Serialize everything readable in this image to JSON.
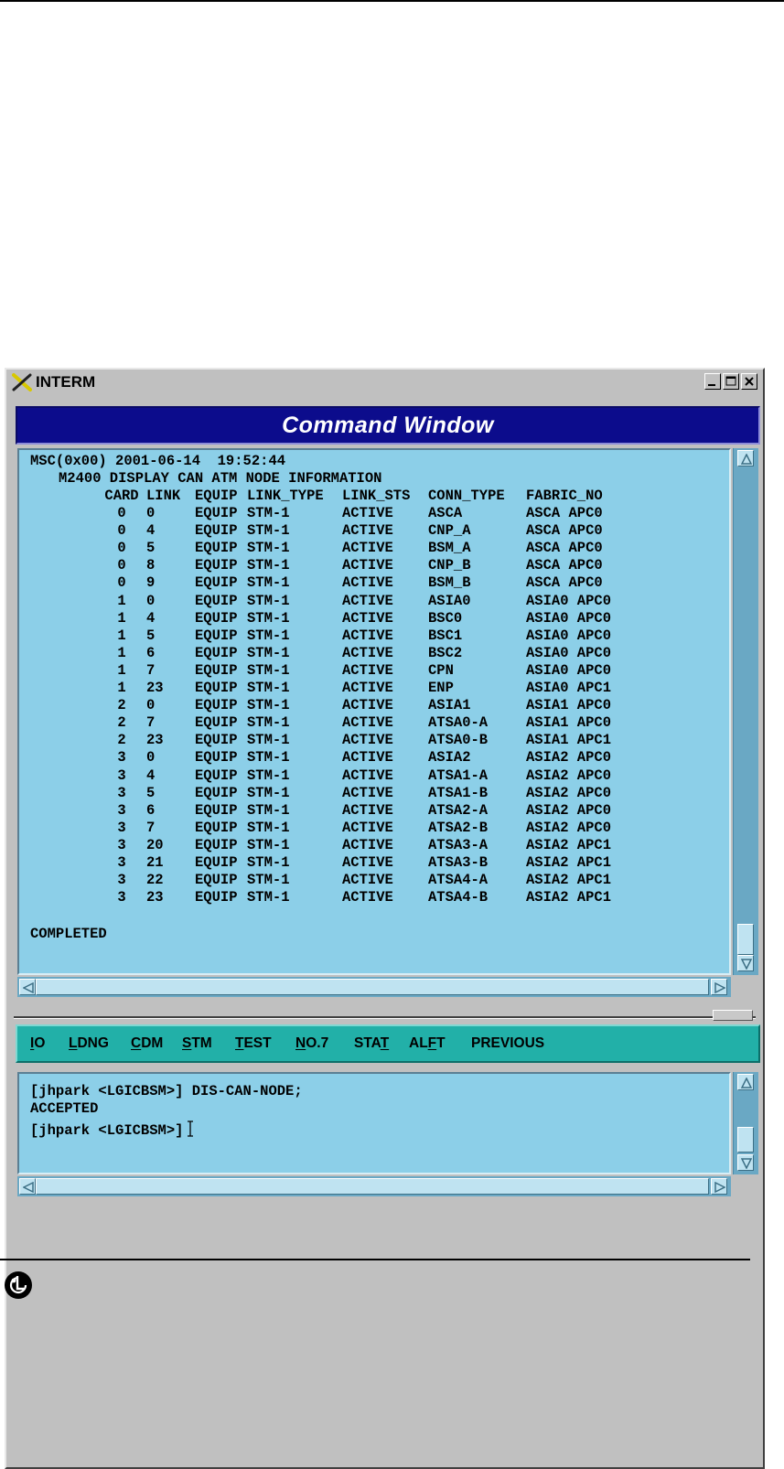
{
  "window": {
    "title": "INTERM",
    "controls": [
      "minimize-icon",
      "maximize-icon",
      "close-icon"
    ]
  },
  "command_window": {
    "title": "Command Window",
    "output": {
      "header_line": "MSC(0x00) 2001-06-14  19:52:44",
      "subtitle_line": "M2400 DISPLAY CAN ATM NODE INFORMATION",
      "columns": [
        "CARD",
        "LINK",
        "EQUIP",
        "LINK_TYPE",
        "LINK_STS",
        "CONN_TYPE",
        "FABRIC_NO"
      ],
      "rows": [
        [
          "0",
          "0",
          "EQUIP",
          "STM-1",
          "ACTIVE",
          "ASCA",
          "ASCA APC0"
        ],
        [
          "0",
          "4",
          "EQUIP",
          "STM-1",
          "ACTIVE",
          "CNP_A",
          "ASCA APC0"
        ],
        [
          "0",
          "5",
          "EQUIP",
          "STM-1",
          "ACTIVE",
          "BSM_A",
          "ASCA APC0"
        ],
        [
          "0",
          "8",
          "EQUIP",
          "STM-1",
          "ACTIVE",
          "CNP_B",
          "ASCA APC0"
        ],
        [
          "0",
          "9",
          "EQUIP",
          "STM-1",
          "ACTIVE",
          "BSM_B",
          "ASCA APC0"
        ],
        [
          "1",
          "0",
          "EQUIP",
          "STM-1",
          "ACTIVE",
          "ASIA0",
          "ASIA0 APC0"
        ],
        [
          "1",
          "4",
          "EQUIP",
          "STM-1",
          "ACTIVE",
          "BSC0",
          "ASIA0 APC0"
        ],
        [
          "1",
          "5",
          "EQUIP",
          "STM-1",
          "ACTIVE",
          "BSC1",
          "ASIA0 APC0"
        ],
        [
          "1",
          "6",
          "EQUIP",
          "STM-1",
          "ACTIVE",
          "BSC2",
          "ASIA0 APC0"
        ],
        [
          "1",
          "7",
          "EQUIP",
          "STM-1",
          "ACTIVE",
          "CPN",
          "ASIA0 APC0"
        ],
        [
          "1",
          "23",
          "EQUIP",
          "STM-1",
          "ACTIVE",
          "ENP",
          "ASIA0 APC1"
        ],
        [
          "2",
          "0",
          "EQUIP",
          "STM-1",
          "ACTIVE",
          "ASIA1",
          "ASIA1 APC0"
        ],
        [
          "2",
          "7",
          "EQUIP",
          "STM-1",
          "ACTIVE",
          "ATSA0-A",
          "ASIA1 APC0"
        ],
        [
          "2",
          "23",
          "EQUIP",
          "STM-1",
          "ACTIVE",
          "ATSA0-B",
          "ASIA1 APC1"
        ],
        [
          "3",
          "0",
          "EQUIP",
          "STM-1",
          "ACTIVE",
          "ASIA2",
          "ASIA2 APC0"
        ],
        [
          "3",
          "4",
          "EQUIP",
          "STM-1",
          "ACTIVE",
          "ATSA1-A",
          "ASIA2 APC0"
        ],
        [
          "3",
          "5",
          "EQUIP",
          "STM-1",
          "ACTIVE",
          "ATSA1-B",
          "ASIA2 APC0"
        ],
        [
          "3",
          "6",
          "EQUIP",
          "STM-1",
          "ACTIVE",
          "ATSA2-A",
          "ASIA2 APC0"
        ],
        [
          "3",
          "7",
          "EQUIP",
          "STM-1",
          "ACTIVE",
          "ATSA2-B",
          "ASIA2 APC0"
        ],
        [
          "3",
          "20",
          "EQUIP",
          "STM-1",
          "ACTIVE",
          "ATSA3-A",
          "ASIA2 APC1"
        ],
        [
          "3",
          "21",
          "EQUIP",
          "STM-1",
          "ACTIVE",
          "ATSA3-B",
          "ASIA2 APC1"
        ],
        [
          "3",
          "22",
          "EQUIP",
          "STM-1",
          "ACTIVE",
          "ATSA4-A",
          "ASIA2 APC1"
        ],
        [
          "3",
          "23",
          "EQUIP",
          "STM-1",
          "ACTIVE",
          "ATSA4-B",
          "ASIA2 APC1"
        ]
      ],
      "footer_line": "COMPLETED"
    }
  },
  "menu": {
    "items": [
      {
        "pre": "",
        "key": "I",
        "post": "O"
      },
      {
        "pre": "",
        "key": "L",
        "post": "DNG"
      },
      {
        "pre": "",
        "key": "C",
        "post": "DM"
      },
      {
        "pre": "",
        "key": "S",
        "post": "TM"
      },
      {
        "pre": "",
        "key": "T",
        "post": "EST"
      },
      {
        "pre": "",
        "key": "N",
        "post": "O.7"
      },
      {
        "pre": "STA",
        "key": "T",
        "post": ""
      },
      {
        "pre": "AL",
        "key": "F",
        "post": "T"
      },
      {
        "pre": "PREVIOUS",
        "key": "",
        "post": ""
      }
    ]
  },
  "input": {
    "lines": [
      "[jhpark <LGICBSM>] DIS-CAN-NODE;",
      "ACCEPTED"
    ],
    "prompt": "[jhpark <LGICBSM>]"
  },
  "colors": {
    "pane_bg": "#8ccfe8",
    "header_bg": "#0c0c8c",
    "menubar_bg": "#22b0a8",
    "window_bg": "#c0c0c0"
  }
}
